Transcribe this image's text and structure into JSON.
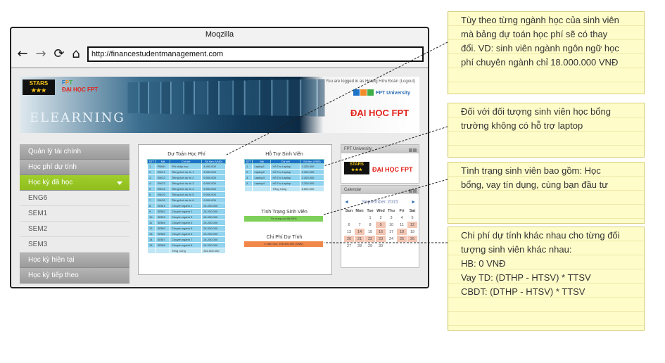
{
  "browser": {
    "title": "Moqzilla",
    "url": "http://financestudentmanagement.com",
    "nav": {
      "back_icon": "←",
      "forward_icon": "→",
      "reload_icon": "⟳",
      "home_icon": "⌂"
    }
  },
  "banner": {
    "stars": "STARS",
    "fpt_small": "ĐẠI HỌC FPT",
    "elearning": "ELEARNING",
    "login_text": "You are logged in as Hoàng Hữu Đoàn (Logout)",
    "fpt_university": "FPT University",
    "dai_hoc_fpt": "ĐẠI HỌC FPT"
  },
  "sidebar": {
    "items": [
      {
        "label": "Quản lý tài chính"
      },
      {
        "label": "Học phí dự tính"
      },
      {
        "label": "Học kỳ đã học"
      }
    ],
    "subitems": [
      "ENG6",
      "SEM1",
      "SEM2",
      "SEM3"
    ],
    "bottom_items": [
      {
        "label": "Học kỳ hiện tại"
      },
      {
        "label": "Học kỳ tiếp theo"
      }
    ]
  },
  "content": {
    "du_toan_title": "Dự Toán Học Phí",
    "du_toan_headers": [
      "STT",
      "Mã",
      "Chi tiết",
      "Số tiền (VNĐ)"
    ],
    "du_toan_rows": [
      [
        "1",
        "PNNH",
        "Phí nhập học",
        "4.400.000"
      ],
      [
        "2",
        "ENG1",
        "Tiếng Anh dự bị 1",
        "9.900.000"
      ],
      [
        "3",
        "ENG2",
        "Tiếng Anh dự bị 2",
        "9.900.000"
      ],
      [
        "4",
        "ENG3",
        "Tiếng Anh dự bị 3",
        "9.900.000"
      ],
      [
        "5",
        "ENG4",
        "Tiếng Anh dự bị 4",
        "9.900.000"
      ],
      [
        "6",
        "ENG5",
        "Tiếng Anh dự bị 5",
        "9.900.000"
      ],
      [
        "7",
        "ENG6",
        "Tiếng Anh dự bị 6",
        "9.900.000"
      ],
      [
        "8",
        "SEM1",
        "Chuyên ngành 1",
        "24.200.000"
      ],
      [
        "9",
        "SEM2",
        "Chuyên ngành 2",
        "24.200.000"
      ],
      [
        "10",
        "SEM3",
        "Chuyên ngành 3",
        "24.200.000"
      ],
      [
        "11",
        "SEM4",
        "Chuyên ngành 4",
        "24.200.000"
      ],
      [
        "12",
        "SEM5",
        "Chuyên ngành 5",
        "24.200.000"
      ],
      [
        "13",
        "SEM6",
        "Chuyên ngành 6",
        "24.200.000"
      ],
      [
        "14",
        "SEM7",
        "Chuyên ngành 7",
        "24.200.000"
      ],
      [
        "15",
        "SEM8",
        "Chuyên ngành 8",
        "24.200.000"
      ]
    ],
    "du_toan_total": [
      "",
      "",
      "Tổng Cộng",
      "261.600.000"
    ],
    "ho_tro_title": "Hỗ Trợ Sinh Viên",
    "ho_tro_headers": [
      "STT",
      "Mã",
      "Chi tiết",
      "Số tiền (VNĐ)"
    ],
    "ho_tro_rows": [
      [
        "1",
        "Laptop1",
        "Hỗ Trợ Laptop",
        "2.200.000"
      ],
      [
        "2",
        "Laptop2",
        "Hỗ Trợ Laptop",
        "2.200.000"
      ],
      [
        "3",
        "Laptop3",
        "Hỗ Trợ Laptop",
        "2.200.000"
      ],
      [
        "4",
        "Laptop4",
        "Hỗ Trợ Laptop",
        "2.200.000"
      ]
    ],
    "ho_tro_total": [
      "",
      "",
      "Tổng Cộng",
      "8.800.000"
    ],
    "tinh_trang_title": "Tình Trạng Sinh Viên",
    "tinh_trang_value": "Tín dụng ưu đãi 50%",
    "chi_phi_title": "Chi Phí Dự Tính",
    "chi_phi_value": "4 năm học: 106.400.000 (VNĐ)"
  },
  "widgets": {
    "fpt_title": "FPT University",
    "fpt_logo_stars": "STARS",
    "fpt_logo_text": "ĐẠI HỌC FPT",
    "calendar_title": "Calendar",
    "calendar_month": "September 2015",
    "calendar_prev": "◄",
    "calendar_next": "►",
    "calendar_days": [
      "Sun",
      "Mon",
      "Tue",
      "Wed",
      "Thu",
      "Fri",
      "Sat"
    ],
    "calendar_weeks": [
      [
        "",
        "",
        "1",
        "2",
        "3",
        "4",
        "5"
      ],
      [
        "6",
        "7",
        "8",
        "9",
        "10",
        "11",
        "12"
      ],
      [
        "13",
        "14",
        "15",
        "16",
        "17",
        "18",
        "19"
      ],
      [
        "20",
        "21",
        "22",
        "23",
        "24",
        "25",
        "26"
      ],
      [
        "27",
        "28",
        "29",
        "30",
        "",
        "",
        ""
      ]
    ],
    "calendar_highlight": [
      "9",
      "12",
      "14",
      "16",
      "18",
      "20",
      "21",
      "22",
      "23",
      "25",
      "26"
    ]
  },
  "notes": [
    {
      "lines": [
        "Tùy theo từng ngành học của sinh viên",
        "mà bảng dự toán học phí sẽ có thay",
        "đổi. VD: sinh viên ngành ngôn ngữ học",
        "phí chuyên ngành chỉ 18.000.000 VNĐ"
      ]
    },
    {
      "lines": [
        "Đối với đối tượng sinh viên học bổng",
        "trường không có hỗ trợ laptop"
      ]
    },
    {
      "lines": [
        "Tình trạng sinh viên bao gồm: Học",
        "bổng, vay tín dụng, cùng bạn đầu tư"
      ]
    },
    {
      "lines": [
        "Chi phí dự tính khác nhau cho từng đối",
        "tượng sinh viên khác nhau:",
        "HB: 0 VNĐ",
        "Vay TD: (DTHP - HTSV) * TTSV",
        "CBDT: (DTHP - HTSV) * TTSV"
      ]
    }
  ],
  "colors": {
    "sidebar_active": "#99c925",
    "table_header": "#1d73c8",
    "table_cell": "#8fd3ee",
    "tinh_trang_bar": "#7fd05a",
    "chi_phi_bar": "#f2874a",
    "note_bg": "#fefcc9"
  }
}
